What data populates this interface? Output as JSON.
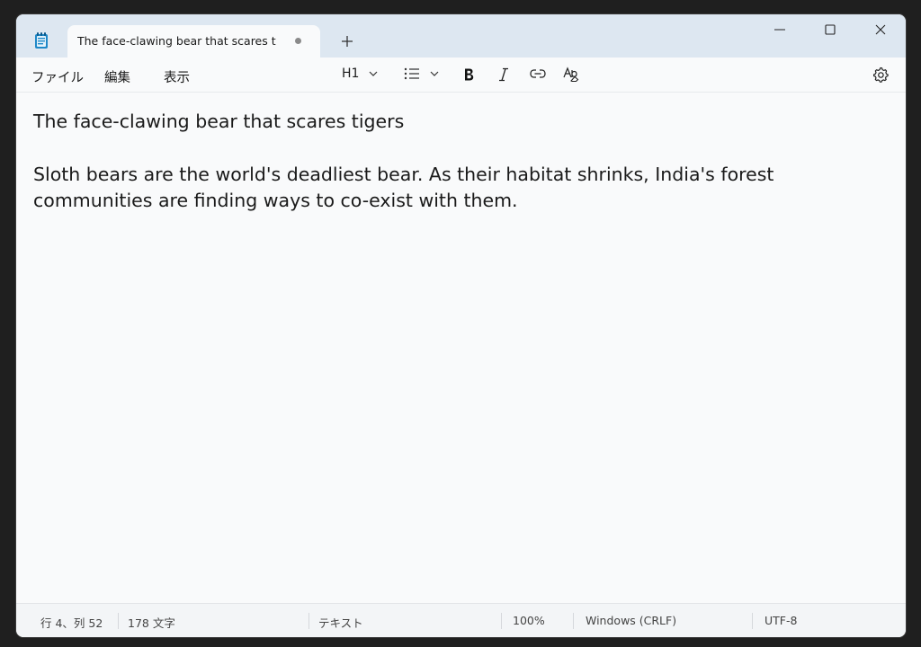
{
  "window": {
    "tab_title": "The face-clawing bear that scares t",
    "tab_state": "unsaved"
  },
  "menu": {
    "file": "ファイル",
    "edit": "編集",
    "view": "表示"
  },
  "toolbar": {
    "heading": "H1",
    "icons": [
      "list-icon",
      "bold-icon",
      "italic-icon",
      "link-icon",
      "clear-formatting-icon",
      "settings-icon"
    ]
  },
  "document": {
    "title": "The face-clawing bear that scares tigers",
    "body": "Sloth bears are the world's deadliest bear. As their habitat shrinks, India's forest communities are finding ways to co-exist with them."
  },
  "status": {
    "position": "行 4、列 52",
    "chars": "178 文字",
    "format": "テキスト",
    "zoom": "100%",
    "line_ending": "Windows (CRLF)",
    "encoding": "UTF-8"
  },
  "colors": {
    "titlebar": "#dde7f1",
    "background": "#f9fafb",
    "text": "#1a1a1a",
    "app_icon": "#1e88c8"
  }
}
